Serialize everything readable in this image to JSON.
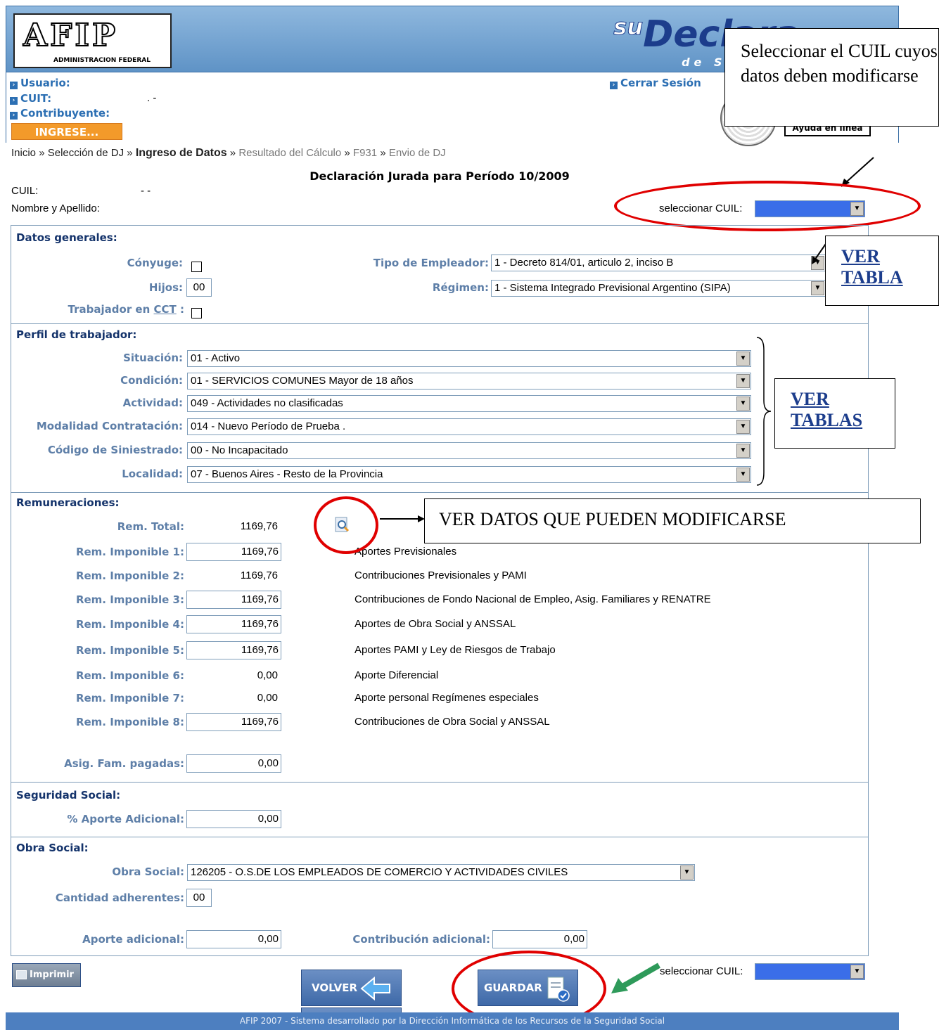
{
  "header": {
    "logo_text": "AFIP",
    "logo_sub": "ADMINISTRACION FEDERAL",
    "brand_prefix": "su",
    "brand_name": "Declara",
    "brand_sub": "de Segurid"
  },
  "user_panel": {
    "usuario_label": "Usuario:",
    "cuit_label": "CUIT:",
    "cuit_value": ".             -",
    "contribuyente_label": "Contribuyente:",
    "ingrese_label": "INGRESE...",
    "logout_label": "Cerrar Sesión",
    "help_label": "Ayuda en línea"
  },
  "breadcrumb": {
    "items": [
      "Inicio",
      "Selección de DJ",
      "Ingreso de Datos",
      "Resultado del Cálculo",
      "F931",
      "Envio de DJ"
    ],
    "separator": "»"
  },
  "page_title": "Declaración Jurada para Período 10/2009",
  "cuil_label": "CUIL:",
  "cuil_value": "-              -",
  "nombre_label": "Nombre y Apellido:",
  "select_cuil_label": "seleccionar CUIL:",
  "datos_generales": {
    "title": "Datos generales:",
    "conyuge_label": "Cónyuge:",
    "hijos_label": "Hijos:",
    "hijos_value": "00",
    "cct_label_prefix": "Trabajador en ",
    "cct_link": "CCT",
    "cct_label_suffix": " :",
    "tipo_empleador_label": "Tipo de Empleador:",
    "tipo_empleador_value": "1 - Decreto 814/01, articulo 2, inciso B",
    "regimen_label": "Régimen:",
    "regimen_value": "1 - Sistema Integrado Previsional Argentino (SIPA)"
  },
  "perfil": {
    "title": "Perfil de trabajador:",
    "fields": [
      {
        "label": "Situación:",
        "value": "01 - Activo"
      },
      {
        "label": "Condición:",
        "value": "01 - SERVICIOS COMUNES Mayor de 18 años"
      },
      {
        "label": "Actividad:",
        "value": "049 - Actividades no clasificadas"
      },
      {
        "label": "Modalidad Contratación:",
        "value": "014 - Nuevo Período de Prueba ."
      },
      {
        "label": "Código de Siniestrado:",
        "value": "00 - No Incapacitado"
      },
      {
        "label": "Localidad:",
        "value": "07 - Buenos Aires - Resto de la Provincia"
      }
    ]
  },
  "remuneraciones": {
    "title": "Remuneraciones:",
    "rows": [
      {
        "label": "Rem. Total:",
        "value": "1169,76",
        "desc": ""
      },
      {
        "label": "Rem. Imponible 1:",
        "value": "1169,76",
        "desc": "Aportes Previsionales"
      },
      {
        "label": "Rem. Imponible 2:",
        "value": "1169,76",
        "desc": "Contribuciones Previsionales y PAMI"
      },
      {
        "label": "Rem. Imponible 3:",
        "value": "1169,76",
        "desc": "Contribuciones de Fondo Nacional de Empleo, Asig. Familiares y RENATRE"
      },
      {
        "label": "Rem. Imponible 4:",
        "value": "1169,76",
        "desc": "Aportes de Obra Social y ANSSAL"
      },
      {
        "label": "Rem. Imponible 5:",
        "value": "1169,76",
        "desc": "Aportes PAMI y Ley de Riesgos de Trabajo"
      },
      {
        "label": "Rem. Imponible 6:",
        "value": "0,00",
        "desc": "Aporte Diferencial"
      },
      {
        "label": "Rem. Imponible 7:",
        "value": "0,00",
        "desc": "Aporte personal Regímenes especiales"
      },
      {
        "label": "Rem. Imponible 8:",
        "value": "1169,76",
        "desc": "Contribuciones de Obra Social y ANSSAL"
      }
    ],
    "asig_label": "Asig. Fam. pagadas:",
    "asig_value": "0,00"
  },
  "seguridad_social": {
    "title": "Seguridad Social:",
    "aporte_label": "% Aporte Adicional:",
    "aporte_value": "0,00"
  },
  "obra_social": {
    "title": "Obra Social:",
    "obra_label": "Obra Social:",
    "obra_value": "126205 - O.S.DE LOS EMPLEADOS DE COMERCIO Y ACTIVIDADES CIVILES",
    "adherentes_label": "Cantidad adherentes:",
    "adherentes_value": "00",
    "aporte_label": "Aporte adicional:",
    "aporte_value": "0,00",
    "contrib_label": "Contribución adicional:",
    "contrib_value": "0,00"
  },
  "buttons": {
    "imprimir": "Imprimir",
    "volver": "VOLVER",
    "guardar": "GUARDAR"
  },
  "callouts": {
    "cuil_note": "Seleccionar el CUIL cuyos datos deben modificarse",
    "ver_tabla_1": "VER",
    "ver_tabla_2": "TABLA",
    "ver_tablas_1": "VER",
    "ver_tablas_2": "TABLAS",
    "ver_datos": "VER DATOS QUE PUEDEN MODIFICARSE"
  },
  "footer": "AFIP 2007 - Sistema desarrollado por la Dirección Informática de los Recursos de la Seguridad Social",
  "colors": {
    "header_blue": "#5f93c6",
    "label_blue": "#5e7fa8",
    "title_navy": "#14336b",
    "orange": "#f39a2a",
    "annotation_red": "#e00000",
    "arrow_green": "#2e9a5a"
  }
}
